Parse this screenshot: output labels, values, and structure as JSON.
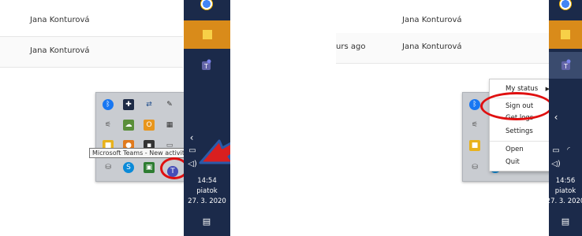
{
  "left": {
    "rows": [
      {
        "name": "Jana Konturová"
      },
      {
        "name": "Jana Konturová"
      }
    ],
    "tooltip": "Microsoft Teams - New activity",
    "clock": {
      "time": "14:54",
      "day": "piatok",
      "date": "27. 3. 2020"
    }
  },
  "right": {
    "rows": [
      {
        "time": "",
        "name": "Jana Konturová"
      },
      {
        "time": "urs ago",
        "name": "Jana Konturová"
      }
    ],
    "menu": {
      "my_status": "My status",
      "sign_out": "Sign out",
      "get_logs": "Get logs",
      "settings": "Settings",
      "open": "Open",
      "quit": "Quit"
    },
    "clock": {
      "time": "14:56",
      "day": "piatok",
      "date": "27. 3. 2020"
    }
  },
  "colors": {
    "taskbar": "#1b2a4a",
    "highlight": "#e01010",
    "arrow_fill": "#d91f1f",
    "arrow_outline": "#2b5aa8"
  },
  "icons": {
    "chevron": "chevron-up-icon",
    "notification": "notification-icon",
    "speaker": "speaker-icon",
    "battery": "battery-icon",
    "wifi": "wifi-icon",
    "submenu_arrow": "submenu-arrow-icon"
  }
}
